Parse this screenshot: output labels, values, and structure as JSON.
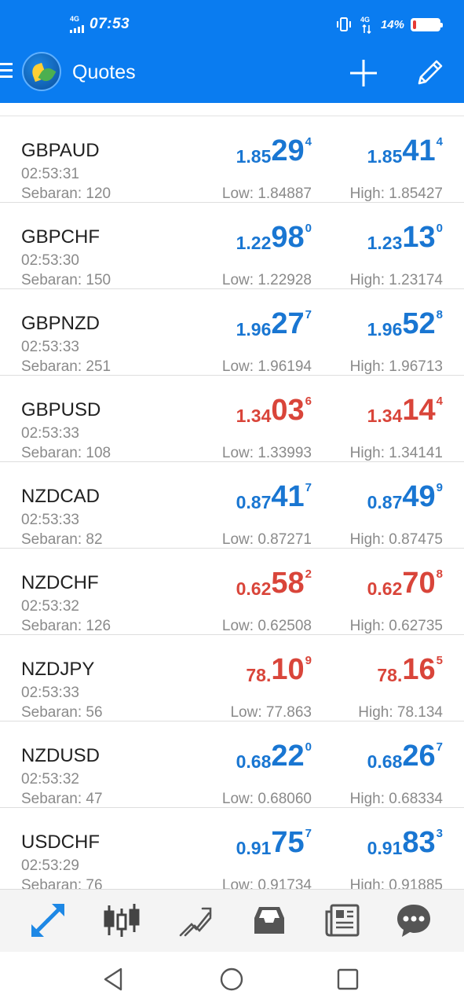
{
  "status_bar": {
    "network_left": "4G",
    "time": "07:53",
    "network_right": "4G",
    "battery": "14%",
    "battery_level": 0.14
  },
  "app_bar": {
    "title": "Quotes",
    "icons": [
      "menu-icon",
      "app-logo",
      "add-icon",
      "edit-icon"
    ]
  },
  "colors": {
    "accent": "#0a7cf0",
    "price_up": "#1976d2",
    "price_down": "#d9453a",
    "secondary_text": "#8a8a8a"
  },
  "quotes": [
    {
      "symbol": "GBPAUD",
      "time": "02:53:31",
      "spread": "Sebaran: 120",
      "direction": "up",
      "bid": {
        "small": "1.85",
        "big": "29",
        "sup": "4"
      },
      "ask": {
        "small": "1.85",
        "big": "41",
        "sup": "4"
      },
      "low": "Low: 1.84887",
      "high": "High: 1.85427"
    },
    {
      "symbol": "GBPCHF",
      "time": "02:53:30",
      "spread": "Sebaran: 150",
      "direction": "up",
      "bid": {
        "small": "1.22",
        "big": "98",
        "sup": "0"
      },
      "ask": {
        "small": "1.23",
        "big": "13",
        "sup": "0"
      },
      "low": "Low: 1.22928",
      "high": "High: 1.23174"
    },
    {
      "symbol": "GBPNZD",
      "time": "02:53:33",
      "spread": "Sebaran: 251",
      "direction": "up",
      "bid": {
        "small": "1.96",
        "big": "27",
        "sup": "7"
      },
      "ask": {
        "small": "1.96",
        "big": "52",
        "sup": "8"
      },
      "low": "Low: 1.96194",
      "high": "High: 1.96713"
    },
    {
      "symbol": "GBPUSD",
      "time": "02:53:33",
      "spread": "Sebaran: 108",
      "direction": "down",
      "bid": {
        "small": "1.34",
        "big": "03",
        "sup": "6"
      },
      "ask": {
        "small": "1.34",
        "big": "14",
        "sup": "4"
      },
      "low": "Low: 1.33993",
      "high": "High: 1.34141"
    },
    {
      "symbol": "NZDCAD",
      "time": "02:53:33",
      "spread": "Sebaran: 82",
      "direction": "up",
      "bid": {
        "small": "0.87",
        "big": "41",
        "sup": "7"
      },
      "ask": {
        "small": "0.87",
        "big": "49",
        "sup": "9"
      },
      "low": "Low: 0.87271",
      "high": "High: 0.87475"
    },
    {
      "symbol": "NZDCHF",
      "time": "02:53:32",
      "spread": "Sebaran: 126",
      "direction": "down",
      "bid": {
        "small": "0.62",
        "big": "58",
        "sup": "2"
      },
      "ask": {
        "small": "0.62",
        "big": "70",
        "sup": "8"
      },
      "low": "Low: 0.62508",
      "high": "High: 0.62735"
    },
    {
      "symbol": "NZDJPY",
      "time": "02:53:33",
      "spread": "Sebaran: 56",
      "direction": "down",
      "bid": {
        "small": "78.",
        "big": "10",
        "sup": "9"
      },
      "ask": {
        "small": "78.",
        "big": "16",
        "sup": "5"
      },
      "low": "Low: 77.863",
      "high": "High: 78.134"
    },
    {
      "symbol": "NZDUSD",
      "time": "02:53:32",
      "spread": "Sebaran: 47",
      "direction": "up",
      "bid": {
        "small": "0.68",
        "big": "22",
        "sup": "0"
      },
      "ask": {
        "small": "0.68",
        "big": "26",
        "sup": "7"
      },
      "low": "Low: 0.68060",
      "high": "High: 0.68334"
    },
    {
      "symbol": "USDCHF",
      "time": "02:53:29",
      "spread": "Sebaran: 76",
      "direction": "up",
      "bid": {
        "small": "0.91",
        "big": "75",
        "sup": "7"
      },
      "ask": {
        "small": "0.91",
        "big": "83",
        "sup": "3"
      },
      "low": "Low: 0.91734",
      "high": "High: 0.91885"
    }
  ],
  "tabs": [
    {
      "name": "quotes",
      "icon": "arrows-icon",
      "active": true
    },
    {
      "name": "chart",
      "icon": "candlestick-icon",
      "active": false
    },
    {
      "name": "trade",
      "icon": "trend-icon",
      "active": false
    },
    {
      "name": "history",
      "icon": "inbox-icon",
      "active": false
    },
    {
      "name": "news",
      "icon": "newspaper-icon",
      "active": false
    },
    {
      "name": "chat",
      "icon": "chat-icon",
      "active": false
    }
  ],
  "system_nav": [
    "back-icon",
    "home-icon",
    "recents-icon"
  ]
}
